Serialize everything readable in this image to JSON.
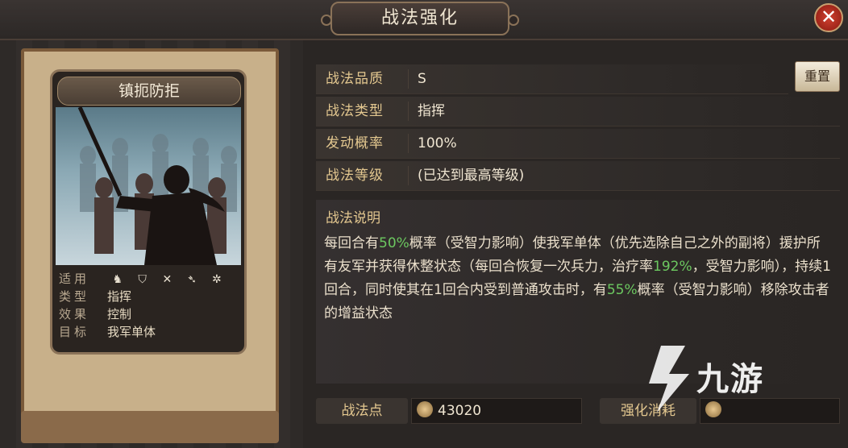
{
  "header": {
    "title": "战法强化",
    "close_label": "✕"
  },
  "card": {
    "name": "镇扼防拒",
    "info": [
      {
        "key": "适用",
        "value": ""
      },
      {
        "key": "类型",
        "value": "指挥"
      },
      {
        "key": "效果",
        "value": "控制"
      },
      {
        "key": "目标",
        "value": "我军单体"
      }
    ],
    "unit_icons": [
      "cavalry-icon",
      "shield-icon",
      "bow-icon",
      "spear-icon",
      "wheel-icon"
    ]
  },
  "reset_label": "重置",
  "details": [
    {
      "label": "战法品质",
      "value": "S"
    },
    {
      "label": "战法类型",
      "value": "指挥"
    },
    {
      "label": "发动概率",
      "value": "100%"
    },
    {
      "label": "战法等级",
      "value": "(已达到最高等级)"
    }
  ],
  "description": {
    "title": "战法说明",
    "parts": [
      {
        "t": "每回合有",
        "hl": false
      },
      {
        "t": "50%",
        "hl": true
      },
      {
        "t": "概率（受智力影响）使我军单体（优先选除自己之外的副将）援护所有友军并获得休整状态（每回合恢复一次兵力，治疗率",
        "hl": false
      },
      {
        "t": "192%",
        "hl": true
      },
      {
        "t": "，受智力影响），持续1回合，同时使其在1回合内受到普通攻击时，有",
        "hl": false
      },
      {
        "t": "55%",
        "hl": true
      },
      {
        "t": "概率（受智力影响）移除攻击者的增益状态",
        "hl": false
      }
    ]
  },
  "bottom": {
    "points_label": "战法点",
    "points_value": "43020",
    "cost_label": "强化消耗",
    "cost_value": ""
  },
  "watermark": {
    "text": "九游"
  },
  "colors": {
    "highlight": "#6cc860",
    "label": "#e4c890"
  }
}
